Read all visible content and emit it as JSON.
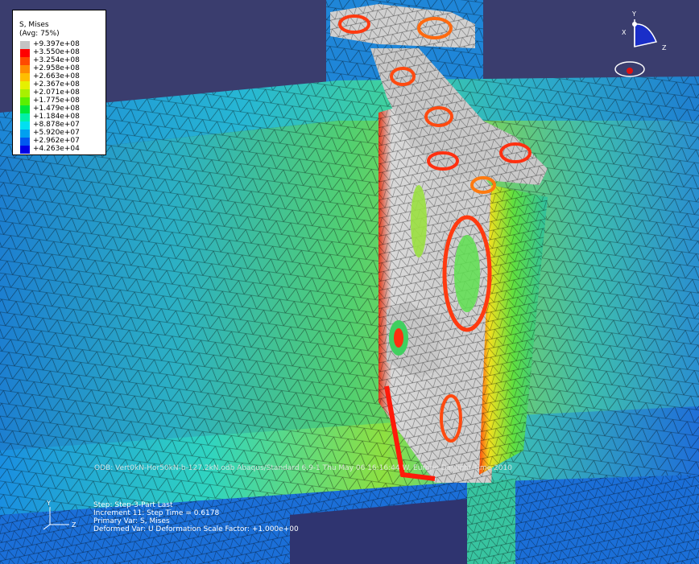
{
  "legend": {
    "title": "S, Mises",
    "subtitle": "(Avg: 75%)",
    "entries": [
      {
        "value": "+9.397e+08",
        "color": "#c4c4c4"
      },
      {
        "value": "+3.550e+08",
        "color": "#ff0000"
      },
      {
        "value": "+3.254e+08",
        "color": "#ff4a00"
      },
      {
        "value": "+2.958e+08",
        "color": "#ff8c00"
      },
      {
        "value": "+2.663e+08",
        "color": "#ffbe00"
      },
      {
        "value": "+2.367e+08",
        "color": "#e6f000"
      },
      {
        "value": "+2.071e+08",
        "color": "#a8f000"
      },
      {
        "value": "+1.775e+08",
        "color": "#5af000"
      },
      {
        "value": "+1.479e+08",
        "color": "#00e83a"
      },
      {
        "value": "+1.184e+08",
        "color": "#00f0a8"
      },
      {
        "value": "+8.878e+07",
        "color": "#00e0f0"
      },
      {
        "value": "+5.920e+07",
        "color": "#00a0f0"
      },
      {
        "value": "+2.962e+07",
        "color": "#0058f0"
      },
      {
        "value": "+4.263e+04",
        "color": "#0000e6"
      }
    ]
  },
  "odb_line": "ODB: Vert0kN-Hor50kN-b-127.2kN.odb    Abaqus/Standard 6.9-1    Thu May 06 16:16:44 W. Europe Daylight Time 2010",
  "step": {
    "line1": "Step: Step-3-Part Last",
    "line2": "Increment     11: Step Time =    0.6178",
    "line3": "Primary Var: S, Mises",
    "line4": "Deformed Var: U   Deformation Scale Factor: +1.000e+00"
  },
  "triad_small": {
    "y": "Y",
    "z": "Z"
  },
  "triad_view": {
    "y": "Y",
    "x": "X",
    "z": "Z"
  }
}
